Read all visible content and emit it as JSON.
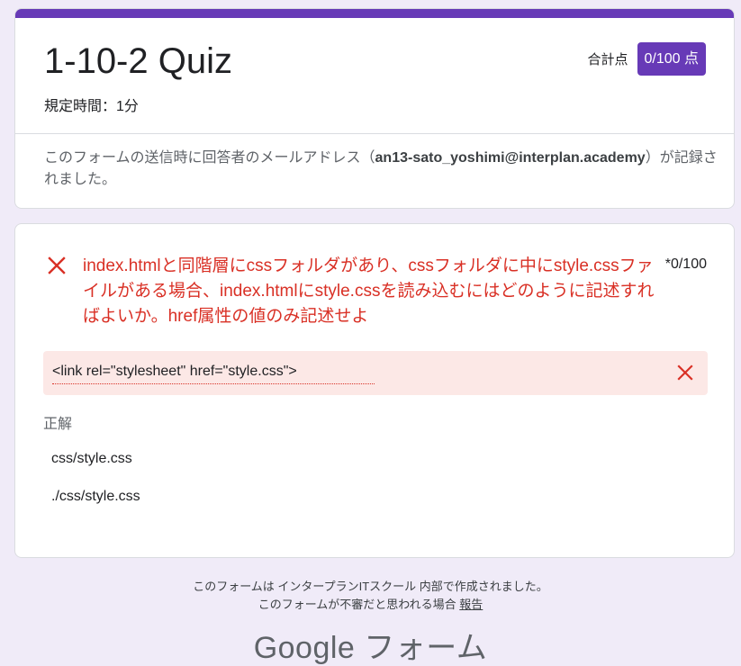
{
  "header": {
    "title": "1-10-2 Quiz",
    "score_label": "合計点",
    "score_value": "0/100 点",
    "time_limit": "規定時間：1分",
    "email_note_prefix": "このフォームの送信時に回答者のメールアドレス（",
    "email": "an13-sato_yoshimi@interplan.academy",
    "email_note_suffix": "）が記録されました。",
    "accent_color": "#673ab7"
  },
  "question": {
    "status_icon": "close-icon",
    "text": "index.htmlと同階層にcssフォルダがあり、cssフォルダに中にstyle.cssファイルがある場合、index.htmlにstyle.cssを読み込むにはどのように記述すればよいか。href属性の値のみ記述せよ",
    "points": "*0/100",
    "user_answer": "<link rel=\"stylesheet\" href=\"style.css\">",
    "correct_label": "正解",
    "correct_answers": [
      "css/style.css",
      "./css/style.css"
    ],
    "error_color": "#d93025"
  },
  "footer": {
    "line1": "このフォームは インタープランITスクール 内部で作成されました。",
    "line2": "このフォームが不審だと思われる場合",
    "report_link": "報告",
    "logo_text": "Google フォーム"
  }
}
